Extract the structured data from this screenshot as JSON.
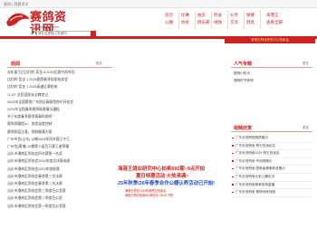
{
  "topbar": {
    "text": "赛鸽 | 鸽赛资讯"
  },
  "logo": {
    "name": "赛鸽资讯网",
    "url": "www.saige.com"
  },
  "search": {
    "placeholder": "请在这里输入关键词"
  },
  "nav": [
    {
      "label": "首页",
      "col": 0,
      "row": 0
    },
    {
      "label": "公棚",
      "col": 0,
      "row": 1
    },
    {
      "label": "比赛",
      "col": 1,
      "row": 0
    },
    {
      "label": "协会",
      "col": 1,
      "row": 1
    },
    {
      "label": "拍卖",
      "col": 2,
      "row": 0
    },
    {
      "label": "俱乐部",
      "col": 2,
      "row": 1
    },
    {
      "label": "鸽舍",
      "col": 3,
      "row": 0
    },
    {
      "label": "视频",
      "col": 3,
      "row": 1
    },
    {
      "label": "分享",
      "col": 4,
      "row": 0
    },
    {
      "label": "交流",
      "col": 4,
      "row": 1
    },
    {
      "label": "保健",
      "col": 5,
      "row": 0
    },
    {
      "label": "鸽具",
      "col": 5,
      "row": 1
    },
    {
      "label": "海港王",
      "col": 6,
      "row": 0
    },
    {
      "label": "查看全部",
      "col": 6,
      "row": 1
    }
  ],
  "banner": {
    "text": "海港王鸽业研究中心拍卖会"
  },
  "news": {
    "title": "鸽闻",
    "more": "更多",
    "items": [
      "去年度王后比利时 奖金 8 2025比赛中再夺冠",
      "比利时 奖金 1 2025赛鸽春季国家拍卖会",
      "比利时 奖金 1 2025高速比赛结束",
      "“4.15” 全民国家安全教育日",
      "2025年全国赛鸽广东地区春赛暨和平杯拍卖",
      "2025年全国春季赛鸽联赛情况通报",
      "关于年度春季赛季赛事的说明",
      "赛鸽保健提示：鸽舍温度控制",
      "赛鸽防疫注意，鸽群健康方案",
      "广州市信(山东) 公棚2024年四关赛王中王",
      "广州信(黄埔) 公棚第十届百万赛王者荣耀",
      "汕头市潮南区鸽协会四关赛第一名奖",
      "汕头市潮南区鸽协会2024年度总决赛成绩",
      "汕头市潮南区鸽协会2024年度联赛",
      "汕头市潮南区鸽协会春季第三关决赛",
      "汕头市潮南区鸽协会春季第二关决赛",
      "汕头市潮南区鸽协会第三季度百公里赛",
      "汕头市潮南区鸽协会第二季度百公里",
      "汕头市潮南区鸽协会第一季度百公里赛"
    ]
  },
  "promo": {
    "line1": "海港王鸽业研究中心拍卖692期~9点开拍",
    "line2": "夏日特惠活动 火热来袭~",
    "line3": "25年秋季/26年春季合作公棚认养活动已开始!",
    "small1": "海港王鸽业2024年度鸽王拍卖会",
    "small2": "海港王鸽业拍卖692期全天 16:00 开拍"
  },
  "hot": {
    "title": "人气专题",
    "more": "更多",
    "items": [
      "赛鸽小知识",
      "清明时节养鸽"
    ]
  },
  "video": {
    "title": "视频欣赏",
    "more": "更多",
    "items": [
      "广东永茂鸽舍赛绩展示",
      "广东永茂鸽舍 鸽王拍卖纪实",
      "广东永茂鸽舍2024 鸽王拍卖会",
      "广东永茂鸽舍 夺冠鸽展示",
      "广东永茂鸽舍 国家级赛事获奖展示",
      "广东永茂鸽舍大型公棚实况",
      "广东永茂鸽舍赛事现场直播",
      "广东永茂鸽舍 赛鸽训练视频"
    ]
  }
}
